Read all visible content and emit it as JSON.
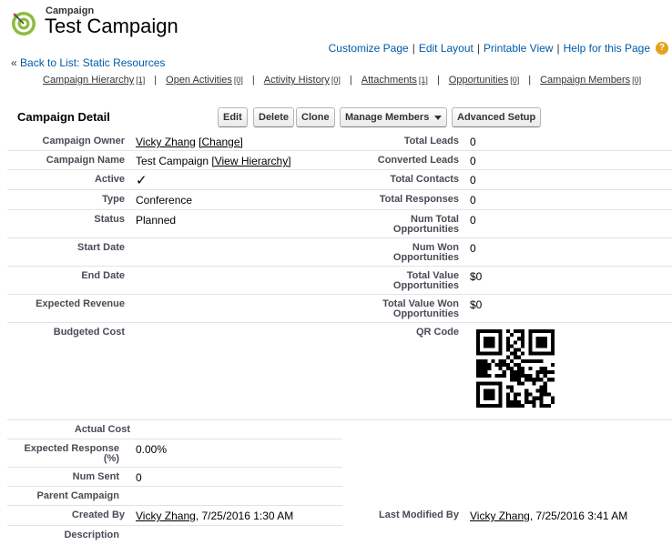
{
  "header": {
    "object_type": "Campaign",
    "title": "Test Campaign"
  },
  "help_links": {
    "customize": "Customize Page",
    "edit_layout": "Edit Layout",
    "printable": "Printable View",
    "help": "Help for this Page",
    "help_icon": "?"
  },
  "back": {
    "prefix": "«",
    "label": "Back to List: Static Resources"
  },
  "related": [
    {
      "label": "Campaign Hierarchy",
      "count": "[1]"
    },
    {
      "label": "Open Activities",
      "count": "[0]"
    },
    {
      "label": "Activity History",
      "count": "[0]"
    },
    {
      "label": "Attachments",
      "count": "[1]"
    },
    {
      "label": "Opportunities",
      "count": "[0]"
    },
    {
      "label": "Campaign Members",
      "count": "[0]"
    }
  ],
  "detail": {
    "title": "Campaign Detail",
    "buttons": {
      "edit": "Edit",
      "delete": "Delete",
      "clone": "Clone",
      "manage_members": "Manage Members",
      "advanced_setup": "Advanced Setup"
    }
  },
  "fields": {
    "owner_label": "Campaign Owner",
    "owner_name": "Vicky Zhang",
    "owner_change": "[Change]",
    "name_label": "Campaign Name",
    "name_value": "Test Campaign",
    "name_hierarchy": "[View Hierarchy]",
    "active_label": "Active",
    "active_value": "✓",
    "type_label": "Type",
    "type_value": "Conference",
    "status_label": "Status",
    "status_value": "Planned",
    "start_label": "Start Date",
    "end_label": "End Date",
    "exp_rev_label": "Expected Revenue",
    "budget_label": "Budgeted Cost",
    "actual_label": "Actual Cost",
    "exp_resp_label": "Expected Response (%)",
    "exp_resp_value": "0.00%",
    "num_sent_label": "Num Sent",
    "num_sent_value": "0",
    "parent_label": "Parent Campaign",
    "created_label": "Created By",
    "created_name": "Vicky Zhang",
    "created_date": ", 7/25/2016 1:30 AM",
    "desc_label": "Description",
    "total_leads_label": "Total Leads",
    "total_leads_value": "0",
    "conv_leads_label": "Converted Leads",
    "conv_leads_value": "0",
    "total_contacts_label": "Total Contacts",
    "total_contacts_value": "0",
    "total_resp_label": "Total Responses",
    "total_resp_value": "0",
    "num_total_opp_label": "Num Total Opportunities",
    "num_total_opp_value": "0",
    "num_won_opp_label": "Num Won Opportunities",
    "num_won_opp_value": "0",
    "total_val_opp_label": "Total Value Opportunities",
    "total_val_opp_value": "$0",
    "total_val_won_label": "Total Value Won Opportunities",
    "total_val_won_value": "$0",
    "qr_label": "QR Code",
    "modified_label": "Last Modified By",
    "modified_name": "Vicky Zhang",
    "modified_date": ", 7/25/2016 3:41 AM"
  },
  "colors": {
    "link": "#015ba7",
    "label": "#4a4a56",
    "divider": "#e3e3e3",
    "help_icon": "#e3a21a",
    "campaign_icon_green": "#8dbb3e"
  },
  "icons": {
    "campaign": "target-icon",
    "help": "help-icon",
    "qr": "qr-code-image"
  }
}
